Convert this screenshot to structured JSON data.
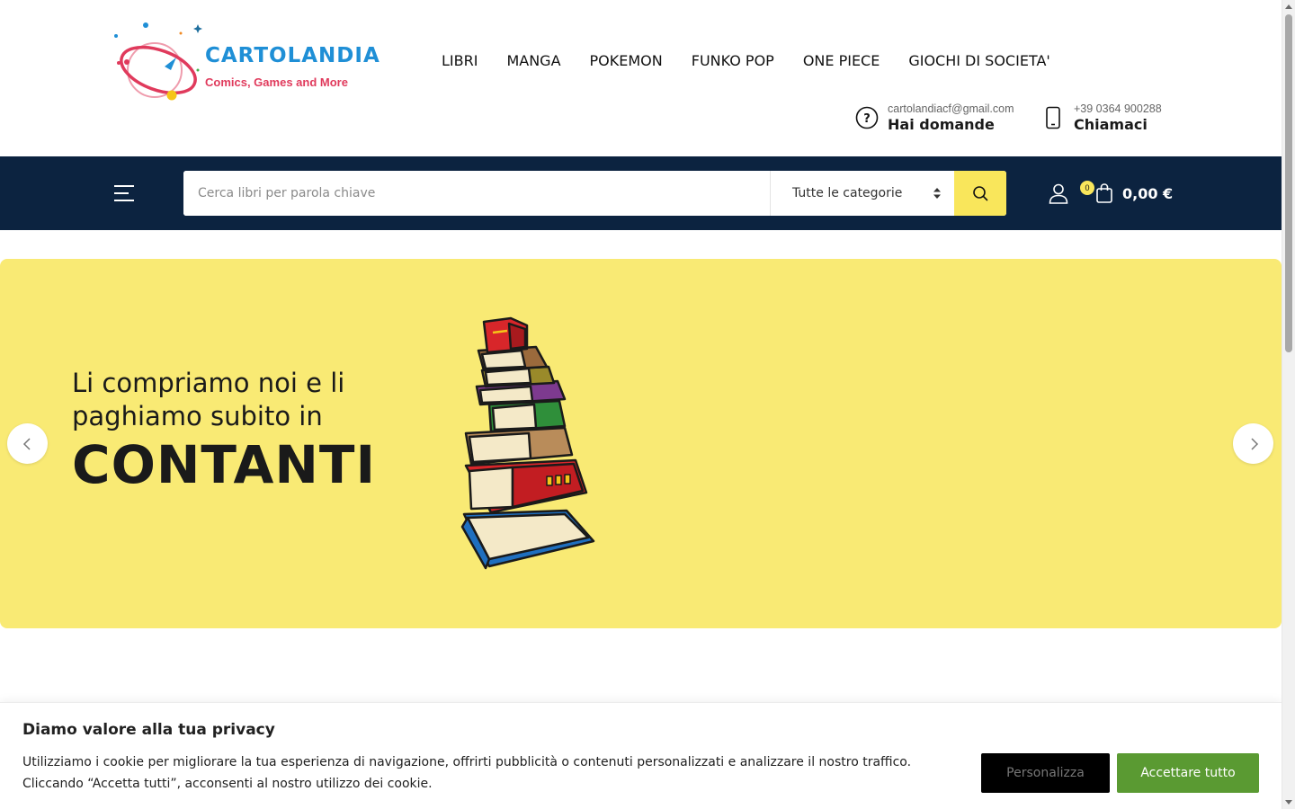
{
  "brand": {
    "name": "CARTOLANDIA",
    "tagline": "Comics, Games and More"
  },
  "nav": [
    {
      "label": "LIBRI"
    },
    {
      "label": "MANGA"
    },
    {
      "label": "POKEMON"
    },
    {
      "label": "FUNKO POP"
    },
    {
      "label": "ONE PIECE"
    },
    {
      "label": "GIOCHI DI SOCIETA'"
    }
  ],
  "contact": {
    "email": {
      "small": "cartolandiacf@gmail.com",
      "big": "Hai domande",
      "icon": "question-circle-icon"
    },
    "phone": {
      "small": "+39 0364 900288",
      "big": "Chiamaci",
      "icon": "smartphone-icon"
    }
  },
  "search": {
    "placeholder": "Cerca libri per parola chiave",
    "value": "",
    "category": "Tutte le categorie"
  },
  "cart": {
    "count": "0",
    "total": "0,00 €"
  },
  "hero": {
    "line1": "Li compriamo noi e li",
    "line2": "paghiamo subito in",
    "highlight": "CONTANTI"
  },
  "cookie": {
    "title": "Diamo valore alla tua privacy",
    "text": "Utilizziamo i cookie per migliorare la tua esperienza di navigazione, offrirti pubblicità o contenuti personalizzati e analizzare il nostro traffico. Cliccando “Accetta tutti”, acconsenti al nostro utilizzo dei cookie.",
    "customize": "Personalizza",
    "accept": "Accettare tutto"
  },
  "colors": {
    "bar": "#0c2340",
    "accent": "#f9e65b",
    "hero_bg": "#f9ea74",
    "accept": "#5a9a32",
    "brand_blue": "#1f8fd6",
    "brand_pink": "#e03a5c"
  }
}
